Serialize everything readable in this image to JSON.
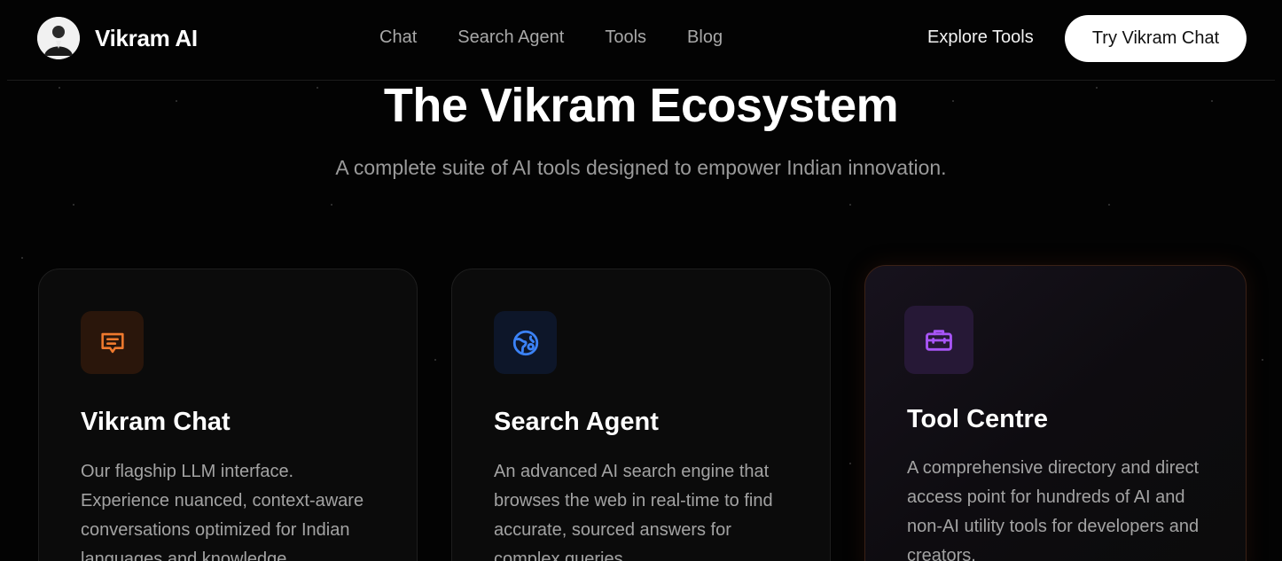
{
  "nav": {
    "brand_name": "Vikram AI",
    "links": [
      {
        "label": "Chat"
      },
      {
        "label": "Search Agent"
      },
      {
        "label": "Tools"
      },
      {
        "label": "Blog"
      }
    ],
    "explore_label": "Explore Tools",
    "cta_label": "Try Vikram Chat"
  },
  "hero": {
    "title": "The Vikram Ecosystem",
    "subtitle": "A complete suite of AI tools designed to empower Indian innovation."
  },
  "cards": [
    {
      "icon": "chat-bubble-icon",
      "accent": "#f07a2e",
      "title": "Vikram Chat",
      "description": "Our flagship LLM interface. Experience nuanced, context-aware conversations optimized for Indian languages and knowledge."
    },
    {
      "icon": "globe-icon",
      "accent": "#3b82f6",
      "title": "Search Agent",
      "description": "An advanced AI search engine that browses the web in real-time to find accurate, sourced answers for complex queries."
    },
    {
      "icon": "toolbox-icon",
      "accent": "#a855f7",
      "title": "Tool Centre",
      "description": "A comprehensive directory and direct access point for hundreds of AI and non-AI utility tools for developers and creators."
    }
  ]
}
